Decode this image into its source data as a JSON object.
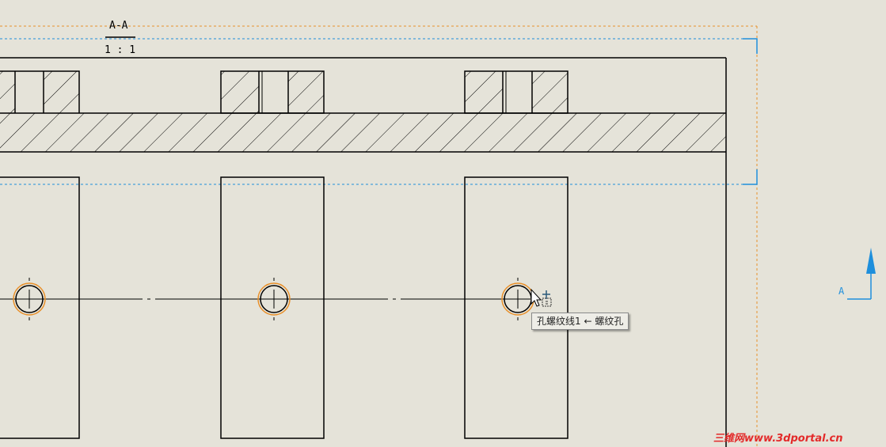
{
  "section_view": {
    "label": "A-A",
    "scale": "1 : 1"
  },
  "section_arrow": {
    "label": "A",
    "color": "#1e8fdc"
  },
  "hover_tooltip": {
    "text": "孔螺纹线1 ← 螺纹孔"
  },
  "watermark": {
    "text": "三维网www.3dportal.cn",
    "color": "#e32a2a"
  },
  "colors": {
    "background": "#e5e3d9",
    "geometry": "#000000",
    "selection_highlight": "#e8902a",
    "view_boundary": "#1e8fdc"
  }
}
